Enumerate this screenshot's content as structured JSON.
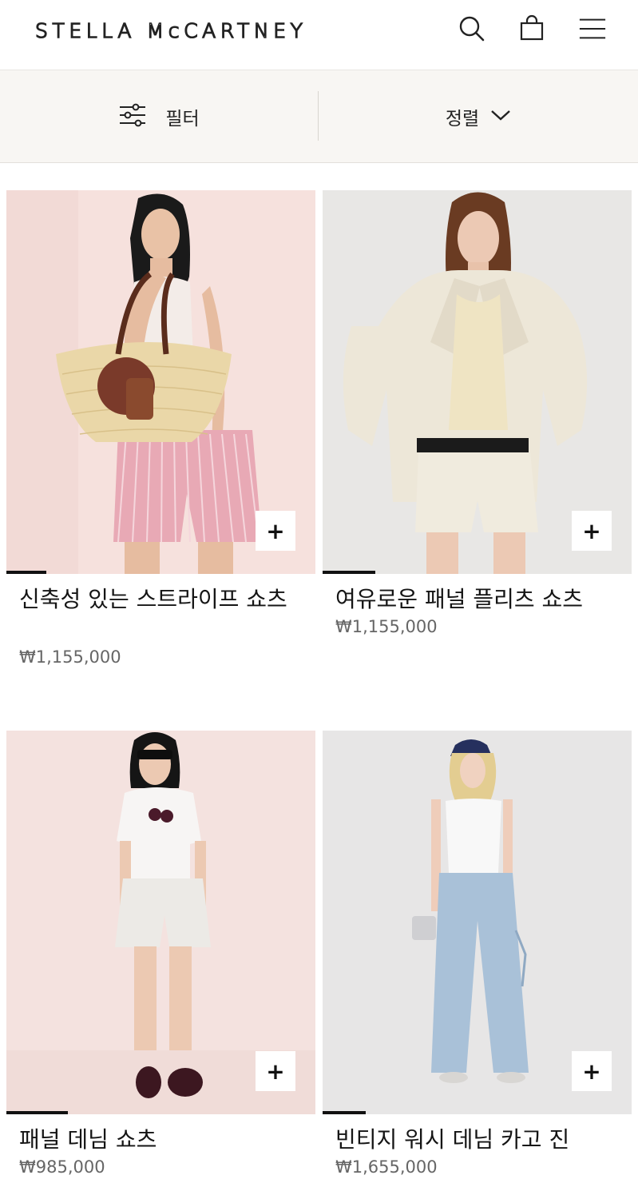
{
  "brand": {
    "logo_text": "STELLA McCARTNEY"
  },
  "header": {
    "icons": [
      "search-icon",
      "bag-icon",
      "menu-icon"
    ]
  },
  "toolbar": {
    "filter_label": "필터",
    "sort_label": "정렬"
  },
  "products": [
    {
      "name": "신축성 있는 스트라이프 쇼츠",
      "price": "₩1,155,000",
      "image_progress": 0.13,
      "add_label": "+"
    },
    {
      "name": "여유로운 패널 플리츠 쇼츠",
      "price": "₩1,155,000",
      "image_progress": 0.17,
      "add_label": "+"
    },
    {
      "name": "패널 데님 쇼츠",
      "price": "₩985,000",
      "image_progress": 0.2,
      "add_label": "+"
    },
    {
      "name": "빈티지 워시 데님 카고 진",
      "price": "₩1,655,000",
      "image_progress": 0.14,
      "add_label": "+"
    }
  ],
  "colors": {
    "accent": "#111111",
    "toolbar_bg": "#f8f6f3",
    "image_bg_pink": "#f5dfdc",
    "image_bg_gray": "#e6e6e6"
  }
}
